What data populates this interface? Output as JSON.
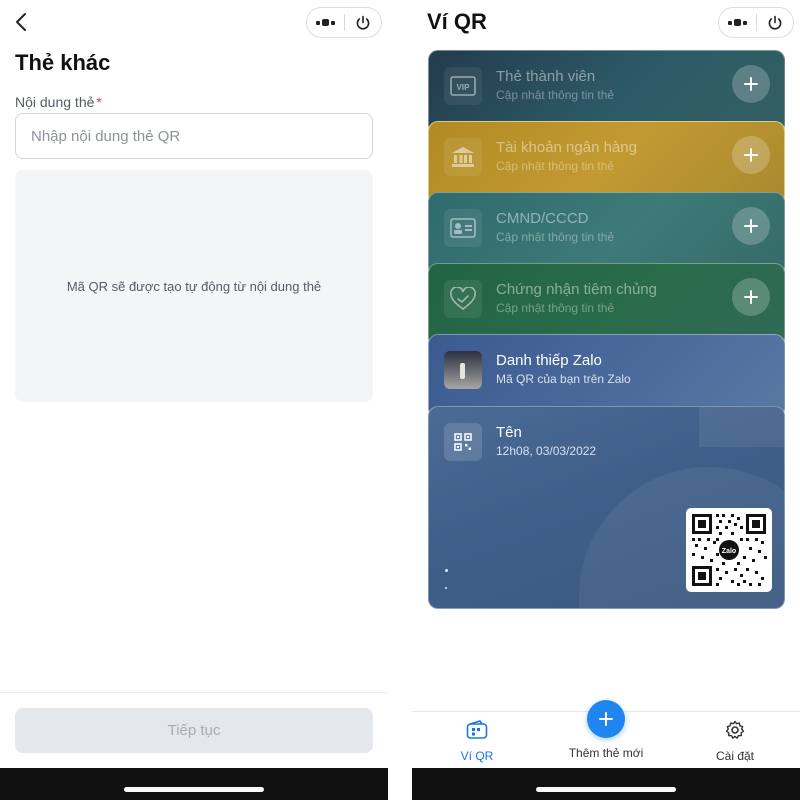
{
  "left": {
    "page_title": "Thẻ khác",
    "field_label": "Nội dung thẻ",
    "required_mark": "*",
    "input_placeholder": "Nhập nội dung thẻ QR",
    "input_value": "",
    "qr_preview_text": "Mã QR sẽ được tạo tự động từ nội dung thẻ",
    "continue_label": "Tiếp tục"
  },
  "right": {
    "page_title": "Ví QR",
    "cards": [
      {
        "title": "Thẻ thành viên",
        "subtitle": "Cập nhật thông tin thẻ",
        "icon": "vip-card-icon"
      },
      {
        "title": "Tài khoản ngân hàng",
        "subtitle": "Cập nhật thông tin thẻ",
        "icon": "bank-icon"
      },
      {
        "title": "CMND/CCCD",
        "subtitle": "Cập nhật thông tin thẻ",
        "icon": "id-card-icon"
      },
      {
        "title": "Chứng nhận tiêm chủng",
        "subtitle": "Cập nhật thông tin thẻ",
        "icon": "vaccine-heart-icon"
      },
      {
        "title": "Danh thiếp Zalo",
        "subtitle": "Mã QR của bạn trên Zalo",
        "icon": "avatar"
      },
      {
        "title": "Tên",
        "subtitle": "12h08, 03/03/2022",
        "icon": "qr-icon"
      }
    ],
    "qr_logo_text": "Zalo",
    "nav": {
      "wallet_label": "Ví QR",
      "add_label": "Thêm thẻ mới",
      "settings_label": "Cài đặt"
    }
  },
  "colors": {
    "accent": "#1e86ee",
    "active_tab": "#1a73e8",
    "required": "#e5383b"
  }
}
